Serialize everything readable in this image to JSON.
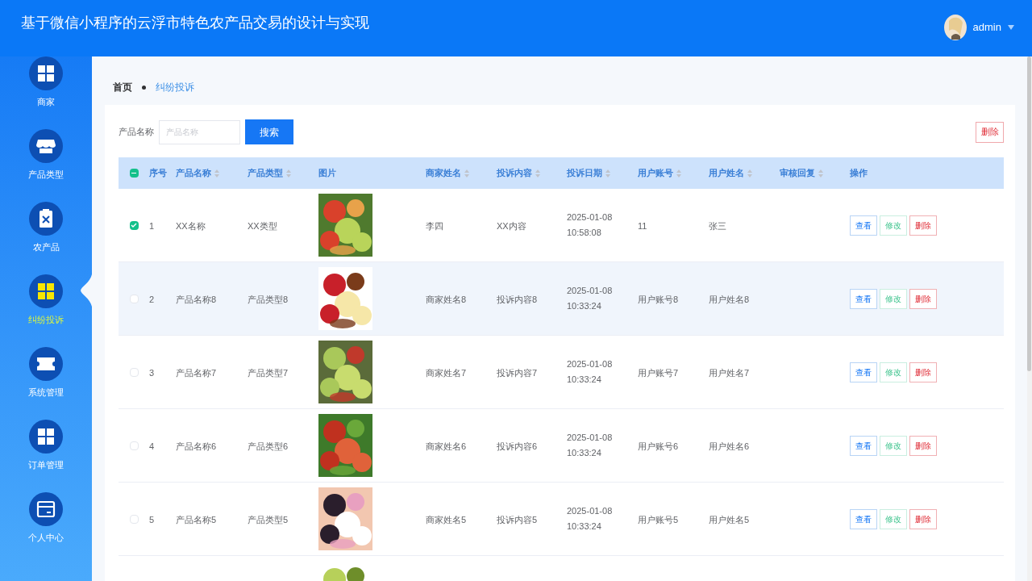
{
  "header": {
    "title": "基于微信小程序的云浮市特色农产品交易的设计与实现",
    "user": "admin"
  },
  "sidebar": {
    "items": [
      {
        "label": "商家",
        "selected": false
      },
      {
        "label": "产品类型",
        "selected": false
      },
      {
        "label": "农产品",
        "selected": false
      },
      {
        "label": "纠纷投诉",
        "selected": true
      },
      {
        "label": "系统管理",
        "selected": false
      },
      {
        "label": "订单管理",
        "selected": false
      },
      {
        "label": "个人中心",
        "selected": false
      }
    ]
  },
  "breadcrumb": [
    "首页",
    "纠纷投诉"
  ],
  "search": {
    "label": "产品名称",
    "placeholder": "产品名称",
    "button": "搜索",
    "delete_button": "删除"
  },
  "table": {
    "select_all_indeterminate": true,
    "columns": [
      {
        "label": "序号",
        "sortable": false
      },
      {
        "label": "产品名称",
        "sortable": true
      },
      {
        "label": "产品类型",
        "sortable": true
      },
      {
        "label": "图片",
        "sortable": false
      },
      {
        "label": "商家姓名",
        "sortable": true
      },
      {
        "label": "投诉内容",
        "sortable": true
      },
      {
        "label": "投诉日期",
        "sortable": true
      },
      {
        "label": "用户账号",
        "sortable": true
      },
      {
        "label": "用户姓名",
        "sortable": true
      },
      {
        "label": "审核回复",
        "sortable": true
      },
      {
        "label": "操作",
        "sortable": false
      }
    ],
    "rows": [
      {
        "checked": true,
        "hovered": false,
        "cells": [
          "1",
          "XX名称",
          "XX类型",
          "XX内容"
        ],
        "merchant": "李四",
        "date": "2025-01-08 10:58:08",
        "account": "11",
        "user": "张三",
        "picture": {
          "kind": "picture"
        },
        "actions": [
          "查看",
          "修改",
          "删除"
        ]
      },
      {
        "checked": false,
        "hovered": true,
        "cells": [
          "2",
          "产品名称8",
          "产品类型8",
          "投诉内容8"
        ],
        "merchant": "商家姓名8",
        "date": "2025-01-08 10:33:24",
        "account": "用户账号8",
        "user": "用户姓名8",
        "picture": {
          "kind": "picture"
        },
        "actions": [
          "查看",
          "修改",
          "删除"
        ]
      },
      {
        "checked": false,
        "hovered": false,
        "cells": [
          "3",
          "产品名称7",
          "产品类型7",
          "投诉内容7"
        ],
        "merchant": "商家姓名7",
        "date": "2025-01-08 10:33:24",
        "account": "用户账号7",
        "user": "用户姓名7",
        "picture": {
          "kind": "picture"
        },
        "actions": [
          "查看",
          "修改",
          "删除"
        ]
      },
      {
        "checked": false,
        "hovered": false,
        "cells": [
          "4",
          "产品名称6",
          "产品类型6",
          "投诉内容6"
        ],
        "merchant": "商家姓名6",
        "date": "2025-01-08 10:33:24",
        "account": "用户账号6",
        "user": "用户姓名6",
        "picture": {
          "kind": "picture"
        },
        "actions": [
          "查看",
          "修改",
          "删除"
        ]
      },
      {
        "checked": false,
        "hovered": false,
        "cells": [
          "5",
          "产品名称5",
          "产品类型5",
          "投诉内容5"
        ],
        "merchant": "商家姓名5",
        "date": "2025-01-08 10:33:24",
        "account": "用户账号5",
        "user": "用户姓名5",
        "picture": {
          "kind": "picture"
        },
        "actions": [
          "查看",
          "修改",
          "删除"
        ]
      }
    ],
    "partial_row": {
      "picture": {
        "kind": "picture"
      }
    }
  }
}
